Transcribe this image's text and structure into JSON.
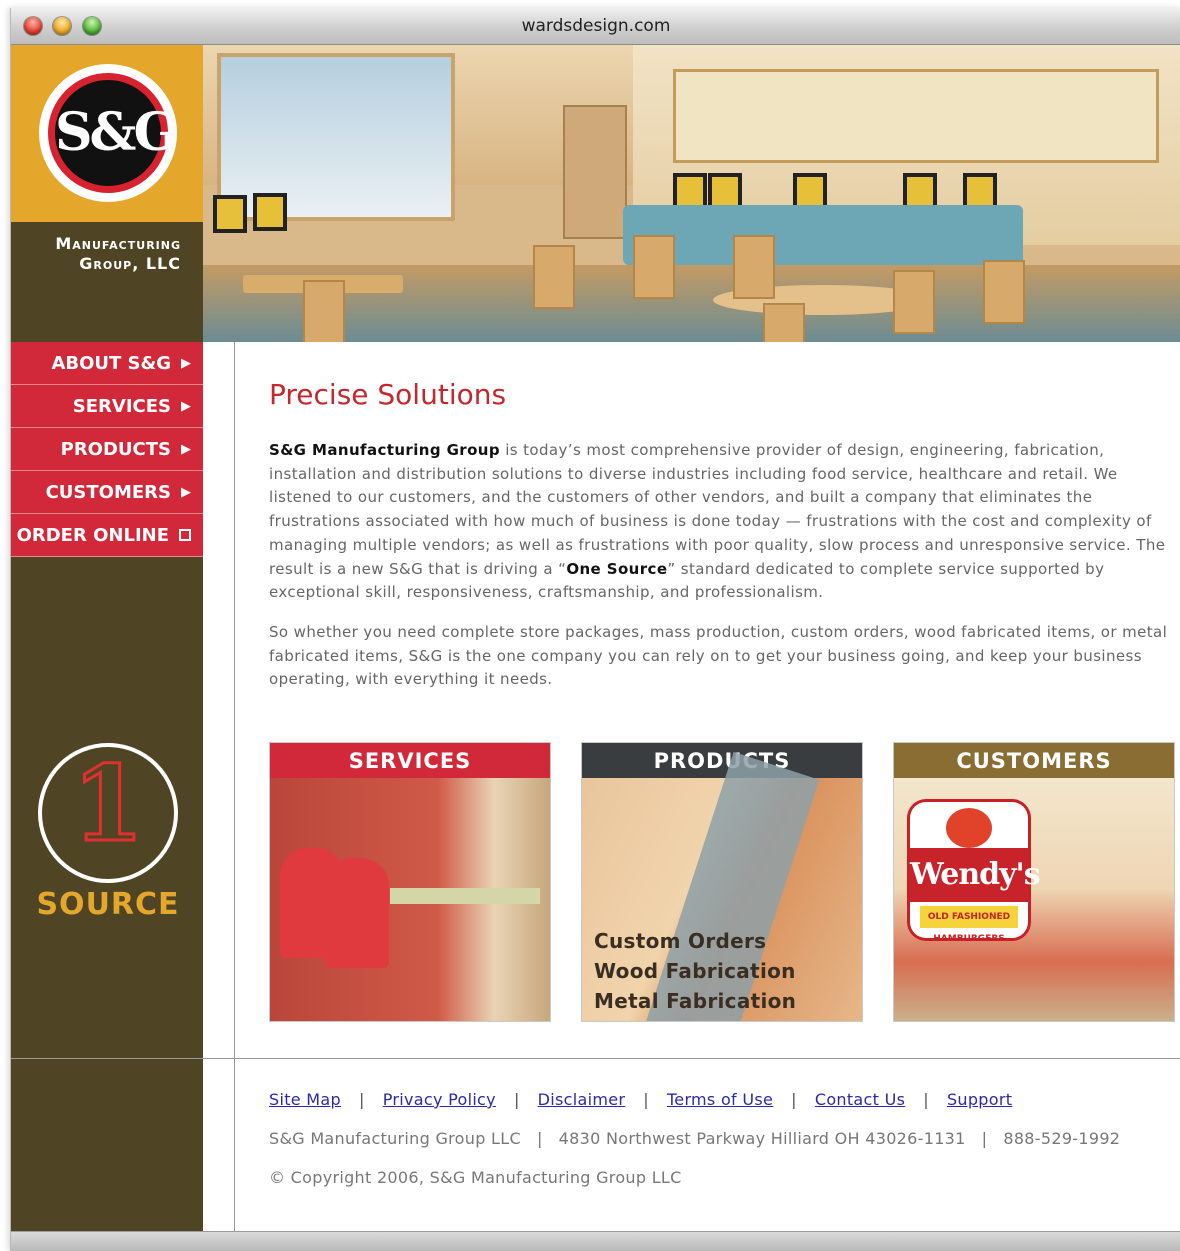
{
  "window": {
    "url": "wardsdesign.com"
  },
  "brand": {
    "logo_text": "S&G",
    "company_line1": "Manufacturing",
    "company_line2": "Group, LLC",
    "source_number": "1",
    "source_word": "SOURCE"
  },
  "nav": [
    {
      "label": "ABOUT S&G",
      "icon": "arrow-right-icon"
    },
    {
      "label": "SERVICES",
      "icon": "arrow-right-icon"
    },
    {
      "label": "PRODUCTS",
      "icon": "arrow-right-icon"
    },
    {
      "label": "CUSTOMERS",
      "icon": "arrow-right-icon"
    },
    {
      "label": "ORDER ONLINE",
      "icon": "external-square-icon"
    }
  ],
  "main": {
    "heading": "Precise Solutions",
    "p1_bold": "S&G Manufacturing Group",
    "p1_text": " is today’s most comprehensive provider of design, engineering, fabrication, installation and distribution solutions to diverse industries including food service, healthcare and retail. We listened to our customers, and the customers of other vendors, and built a company that eliminates the frustrations associated with how much of business is done today — frustrations with the cost and complexity of managing multiple vendors; as well as frustrations with poor quality, slow process and unresponsive service. The result is a new S&G that is driving a “",
    "p1_bold2": "One Source",
    "p1_text2": "” standard dedicated to complete service supported by exceptional skill, responsiveness, craftsmanship, and professionalism.",
    "p2": "So whether you need complete store packages, mass production, custom orders, wood fabricated items, or metal fabricated items, S&G is the one company you can rely on to get your business going, and keep your business operating, with everything it needs."
  },
  "tiles": [
    {
      "title": "SERVICES"
    },
    {
      "title": "PRODUCTS",
      "lines": [
        "Custom Orders",
        "Wood Fabrication",
        "Metal Fabrication"
      ]
    },
    {
      "title": "CUSTOMERS",
      "sign_name": "Wendy's",
      "sign_sub": "OLD FASHIONED HAMBURGERS"
    }
  ],
  "footer": {
    "links": [
      "Site Map",
      "Privacy Policy",
      "Disclaimer",
      "Terms of Use",
      "Contact Us",
      "Support"
    ],
    "separator": "|",
    "address": [
      "S&G Manufacturing Group LLC",
      "4830 Northwest Parkway Hilliard OH 43026-1131",
      "888-529-1992"
    ],
    "copyright": "© Copyright 2006, S&G Manufacturing Group LLC"
  },
  "colors": {
    "brand_red": "#d1283a",
    "brand_gold": "#e4a72b",
    "brand_brown": "#4f4423",
    "heading_red": "#c3282f"
  }
}
